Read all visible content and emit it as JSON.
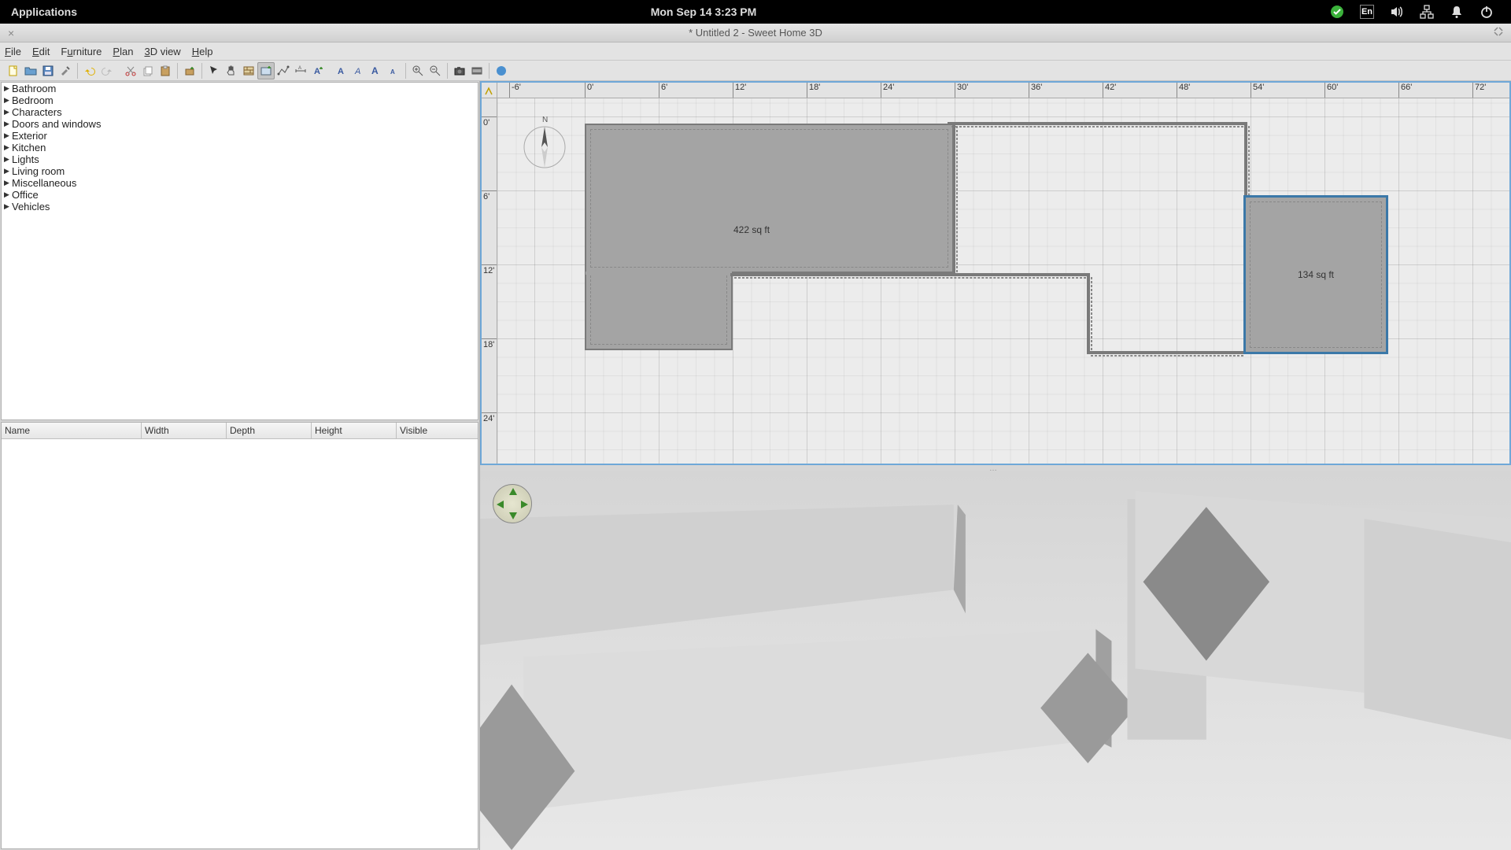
{
  "sysbar": {
    "applications": "Applications",
    "datetime": "Mon Sep 14   3:23 PM",
    "input_method": "En"
  },
  "window": {
    "title": "* Untitled 2 - Sweet Home 3D"
  },
  "menubar": {
    "file": "File",
    "edit": "Edit",
    "furniture": "Furniture",
    "plan": "Plan",
    "view3d": "3D view",
    "help": "Help",
    "file_u": "F",
    "edit_u": "E",
    "furniture_u": "u",
    "plan_u": "P",
    "view3d_u": "3",
    "help_u": "H"
  },
  "catalog": {
    "items": [
      "Bathroom",
      "Bedroom",
      "Characters",
      "Doors and windows",
      "Exterior",
      "Kitchen",
      "Lights",
      "Living room",
      "Miscellaneous",
      "Office",
      "Vehicles"
    ]
  },
  "furniture_table": {
    "columns": [
      "Name",
      "Width",
      "Depth",
      "Height",
      "Visible"
    ]
  },
  "plan": {
    "ruler_h_ticks": [
      "-6'",
      "0'",
      "6'",
      "12'",
      "18'",
      "24'",
      "30'",
      "36'",
      "42'",
      "48'",
      "54'",
      "60'",
      "66'",
      "72'"
    ],
    "ruler_h_pos": [
      15,
      111,
      205,
      299,
      393,
      487,
      581,
      675,
      769,
      863,
      957,
      1051,
      1145,
      1239
    ],
    "ruler_v_ticks": [
      "0'",
      "6'",
      "12'",
      "18'",
      "24'"
    ],
    "ruler_v_pos": [
      23,
      117,
      211,
      305,
      399
    ],
    "rooms": {
      "big_label": "422 sq ft",
      "small_label": "134 sq ft"
    }
  }
}
